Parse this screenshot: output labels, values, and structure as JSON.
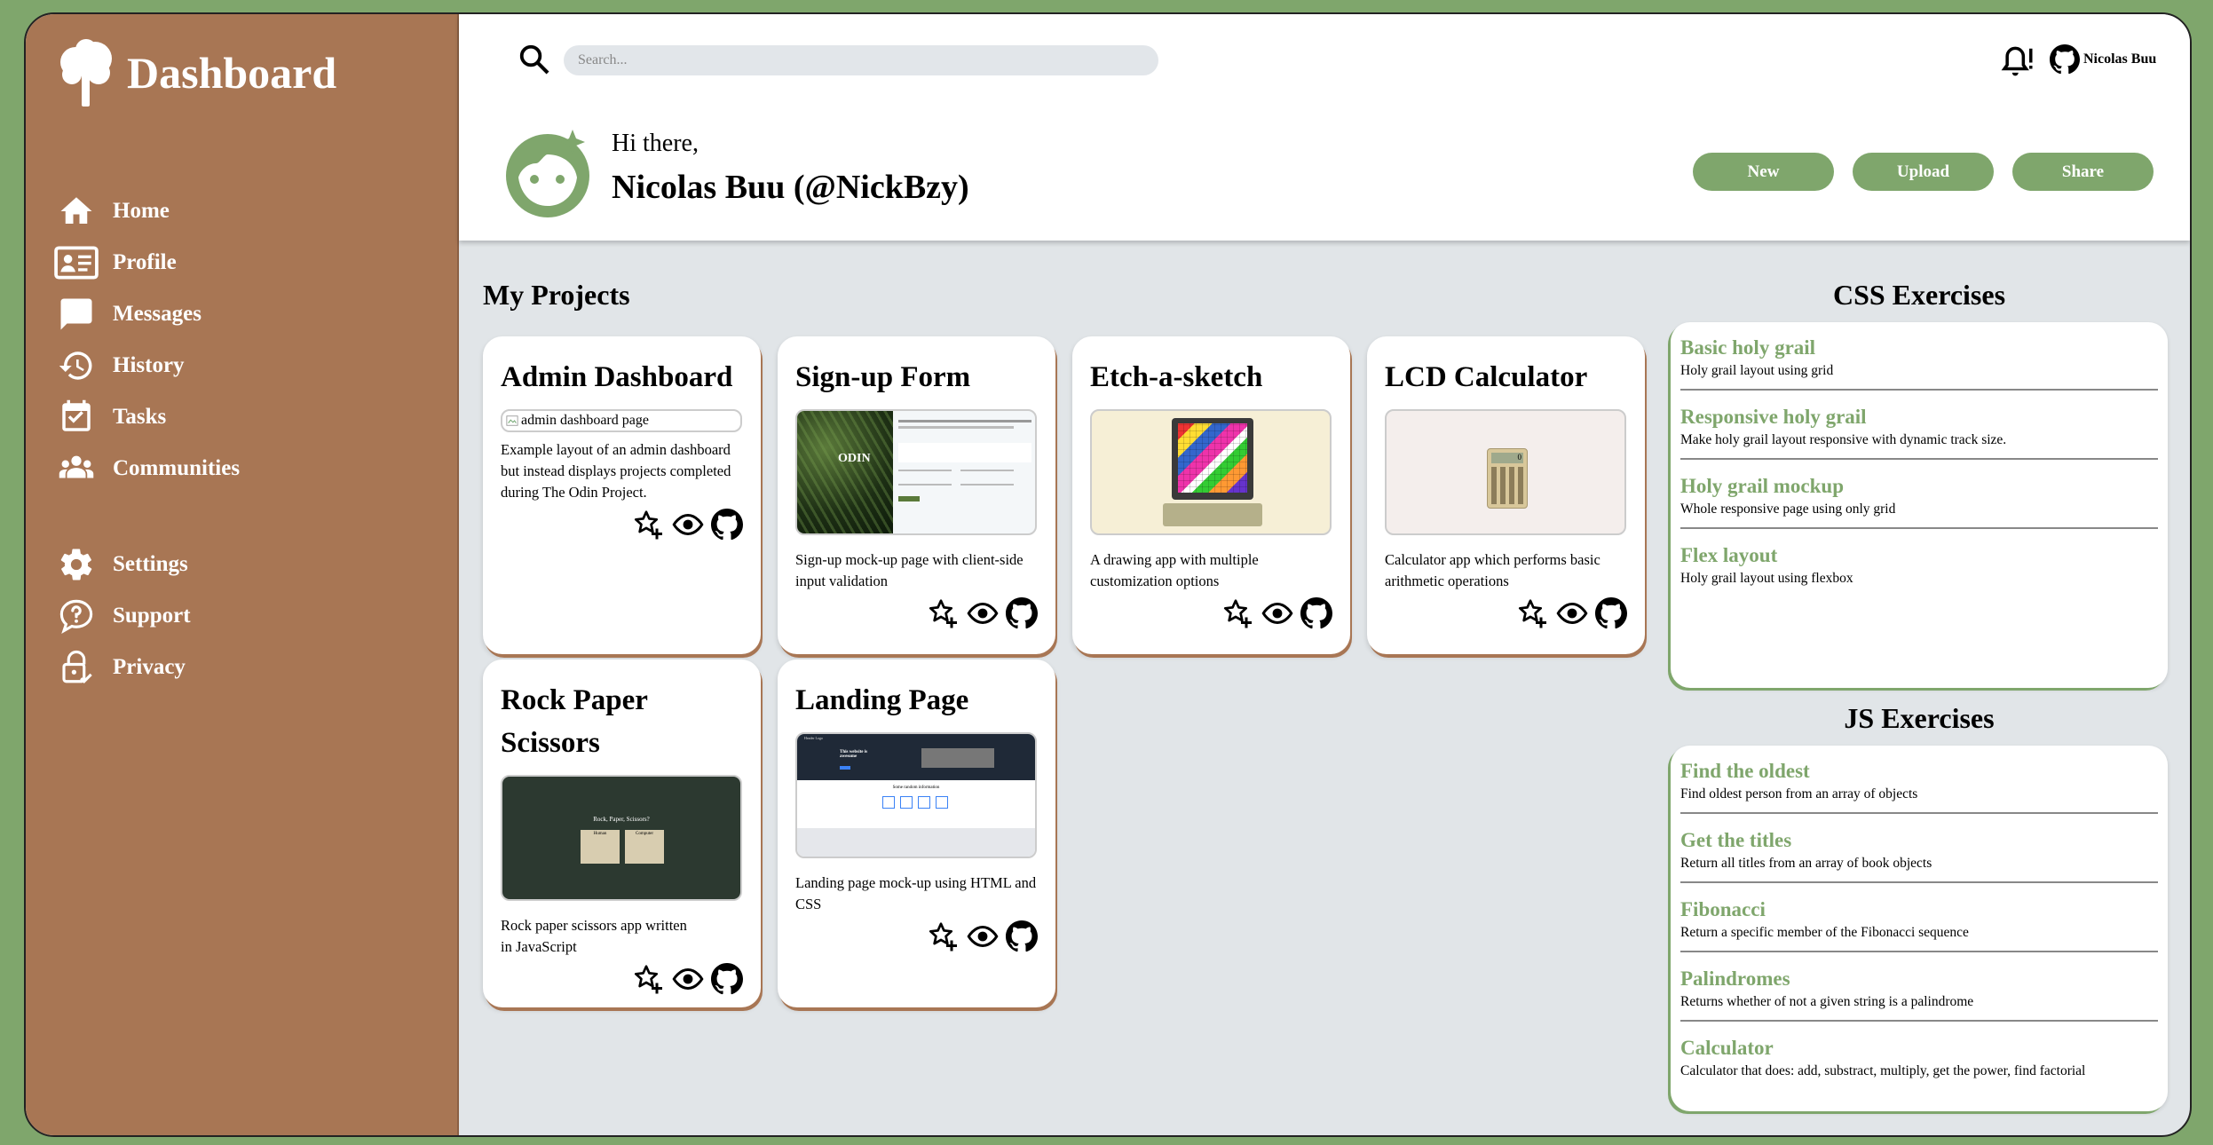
{
  "sidebar": {
    "brand_title": "Dashboard",
    "items": [
      {
        "label": "Home",
        "icon": "home-icon"
      },
      {
        "label": "Profile",
        "icon": "id-card-icon"
      },
      {
        "label": "Messages",
        "icon": "message-icon"
      },
      {
        "label": "History",
        "icon": "history-icon"
      },
      {
        "label": "Tasks",
        "icon": "calendar-check-icon"
      },
      {
        "label": "Communities",
        "icon": "people-icon"
      },
      {
        "label": "Settings",
        "icon": "gear-icon"
      },
      {
        "label": "Support",
        "icon": "question-icon"
      },
      {
        "label": "Privacy",
        "icon": "lock-check-icon"
      }
    ]
  },
  "header": {
    "search_placeholder": "Search...",
    "user_short": "Nicolas Buu",
    "greeting": "Hi there,",
    "user_full": "Nicolas Buu (@NickBzy)",
    "buttons": {
      "new": "New",
      "upload": "Upload",
      "share": "Share"
    }
  },
  "projects": {
    "title": "My Projects",
    "cards": [
      {
        "title": "Admin Dashboard",
        "image_alt": "admin dashboard page",
        "description": "Example layout of an admin dashboard but instead displays projects completed during The Odin Project."
      },
      {
        "title": "Sign-up Form",
        "description": "Sign-up mock-up page with client-side input validation"
      },
      {
        "title": "Etch-a-sketch",
        "description": "A drawing app with multiple customization options"
      },
      {
        "title": "LCD Calculator",
        "description": "Calculator app which performs basic arithmetic operations"
      },
      {
        "title": "Rock Paper Scissors",
        "description": "Rock paper scissors app written in JavaScript"
      },
      {
        "title": "Landing Page",
        "description": "Landing page mock-up using HTML and CSS"
      }
    ]
  },
  "css_exercises": {
    "title": "CSS Exercises",
    "items": [
      {
        "name": "Basic holy grail",
        "desc": "Holy grail layout using grid"
      },
      {
        "name": "Responsive holy grail",
        "desc": "Make holy grail layout responsive with dynamic track size."
      },
      {
        "name": "Holy grail mockup",
        "desc": "Whole responsive page using only grid"
      },
      {
        "name": "Flex layout",
        "desc": "Holy grail layout using flexbox"
      }
    ]
  },
  "js_exercises": {
    "title": "JS Exercises",
    "items": [
      {
        "name": "Find the oldest",
        "desc": "Find oldest person from an array of objects"
      },
      {
        "name": "Get the titles",
        "desc": "Return all titles from an array of book objects"
      },
      {
        "name": "Fibonacci",
        "desc": "Return a specific member of the Fibonacci sequence"
      },
      {
        "name": "Palindromes",
        "desc": "Returns whether of not a given string is a palindrome"
      },
      {
        "name": "Calculator",
        "desc": "Calculator that does: add, substract, multiply, get the power, find factorial"
      }
    ]
  },
  "thumb_text": {
    "odin": "ODIN",
    "rps_title": "Rock, Paper, Scissors?",
    "rps_you": "Human",
    "rps_cpu": "Computer",
    "landing_brand": "Header Logo",
    "landing_hero": "This website is awesome",
    "landing_section": "Some random information",
    "calc_display": "0"
  },
  "colors": {
    "accent": "#7fa66c",
    "sidebar": "#a87654",
    "background": "#e1e5e8"
  }
}
